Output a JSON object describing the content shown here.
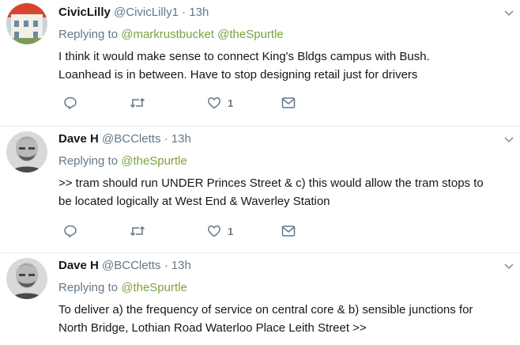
{
  "tweets": [
    {
      "name": "CivicLilly",
      "handle": "@CivicLilly1",
      "separator": "·",
      "time": "13h",
      "replying_prefix": "Replying to",
      "mentions": [
        "@markrustbucket",
        "@theSpurtle"
      ],
      "text_lines": [
        "I think it would make sense to connect King's Bldgs campus with Bush.",
        "Loanhead is in between. Have to stop designing retail just for drivers"
      ],
      "like_count": "1",
      "avatar": "house-avatar"
    },
    {
      "name": "Dave H",
      "handle": "@BCCletts",
      "separator": "·",
      "time": "13h",
      "replying_prefix": "Replying to",
      "mentions": [
        "@theSpurtle"
      ],
      "text_lines": [
        ">> tram should run UNDER Princes Street & c) this would allow the tram stops to",
        "be located logically at West End & Waverley Station"
      ],
      "like_count": "1",
      "avatar": "man-avatar"
    },
    {
      "name": "Dave H",
      "handle": "@BCCletts",
      "separator": "·",
      "time": "13h",
      "replying_prefix": "Replying to",
      "mentions": [
        "@theSpurtle"
      ],
      "text_lines": [
        "To deliver a) the frequency of service on central core & b) sensible junctions for",
        "North Bridge, Lothian Road Waterloo Place Leith Street >>"
      ],
      "avatar": "man-avatar"
    }
  ],
  "icons": {
    "reply": "reply-icon",
    "retweet": "retweet-icon",
    "like": "heart-icon",
    "dm": "envelope-icon",
    "menu": "chevron-down-icon"
  },
  "colors": {
    "mention": "#7ba23f",
    "muted": "#657786",
    "text": "#14171a",
    "divider": "#e6ecf0"
  }
}
